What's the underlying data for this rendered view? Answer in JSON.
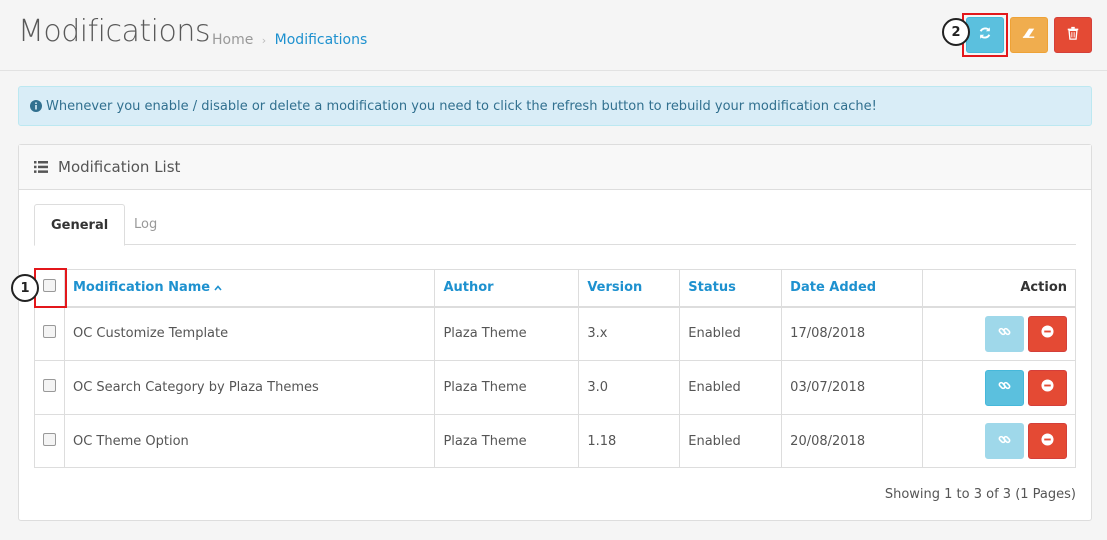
{
  "header": {
    "title": "Modifications",
    "breadcrumb": {
      "home": "Home",
      "separator": "›",
      "current": "Modifications"
    },
    "buttons": {
      "refresh_icon": "refresh-icon",
      "clear_icon": "eraser-icon",
      "delete_icon": "trash-icon"
    }
  },
  "callouts": {
    "one": "1",
    "two": "2"
  },
  "alert": {
    "icon": "info-circle-icon",
    "text": "Whenever you enable / disable or delete a modification you need to click the refresh button to rebuild your modification cache!"
  },
  "panel": {
    "title": "Modification List",
    "tabs": [
      "General",
      "Log"
    ],
    "columns": {
      "name": "Modification Name",
      "author": "Author",
      "version": "Version",
      "status": "Status",
      "date": "Date Added",
      "action": "Action"
    },
    "rows": [
      {
        "name": "OC Customize Template",
        "author": "Plaza Theme",
        "version": "3.x",
        "status": "Enabled",
        "date": "17/08/2018"
      },
      {
        "name": "OC Search Category by Plaza Themes",
        "author": "Plaza Theme",
        "version": "3.0",
        "status": "Enabled",
        "date": "03/07/2018"
      },
      {
        "name": "OC Theme Option",
        "author": "Plaza Theme",
        "version": "1.18",
        "status": "Enabled",
        "date": "20/08/2018"
      }
    ],
    "pagination": "Showing 1 to 3 of 3 (1 Pages)"
  },
  "colors": {
    "primary": "#1e91cf",
    "info": "#5bc0de",
    "warning": "#f0ad4e",
    "danger": "#e44a34",
    "highlight": "#e3171b"
  }
}
